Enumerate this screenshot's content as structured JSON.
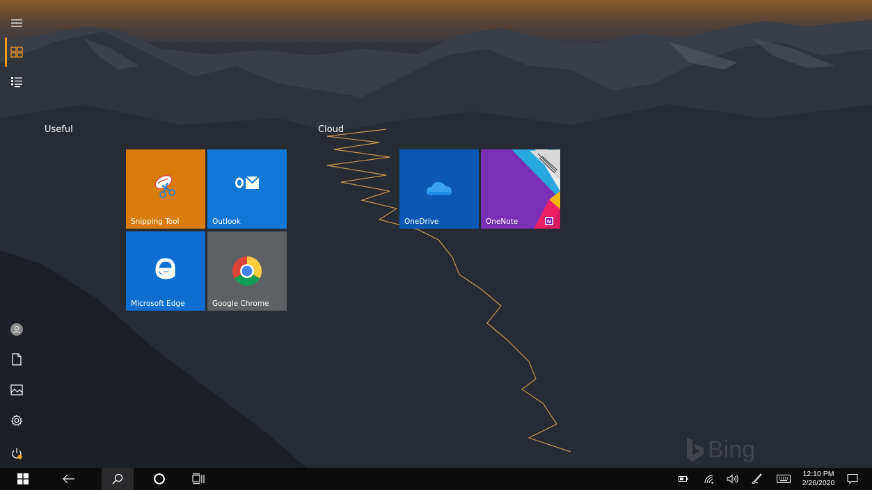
{
  "groups": {
    "useful": {
      "title": "Useful"
    },
    "cloud": {
      "title": "Cloud"
    }
  },
  "tiles": {
    "snipping_tool": {
      "label": "Snipping Tool",
      "color": "#d97c0b"
    },
    "outlook": {
      "label": "Outlook",
      "color": "#0f78d4"
    },
    "edge": {
      "label": "Microsoft Edge",
      "color": "#0f6fd0"
    },
    "chrome": {
      "label": "Google Chrome",
      "color": "#5e6064"
    },
    "onedrive": {
      "label": "OneDrive",
      "color": "#0a58b4"
    },
    "onenote": {
      "label": "OneNote",
      "color": "#7a2fb5"
    }
  },
  "rail": {
    "items": [
      "hamburger-icon",
      "tiles-icon",
      "all-apps-icon",
      "user-icon",
      "documents-icon",
      "pictures-icon",
      "settings-icon",
      "power-icon"
    ],
    "accent": "#f39c1f"
  },
  "taskbar": {
    "buttons": [
      "windows-icon",
      "back-icon",
      "search-icon",
      "cortana-icon",
      "task-view-icon"
    ],
    "tray": [
      "battery-icon",
      "wifi-icon",
      "volume-icon",
      "pen-icon",
      "keyboard-icon",
      "action-center-icon"
    ],
    "clock": {
      "time": "12:10 PM",
      "date": "2/26/2020"
    }
  },
  "wallpaper": {
    "watermark": "Bing"
  }
}
